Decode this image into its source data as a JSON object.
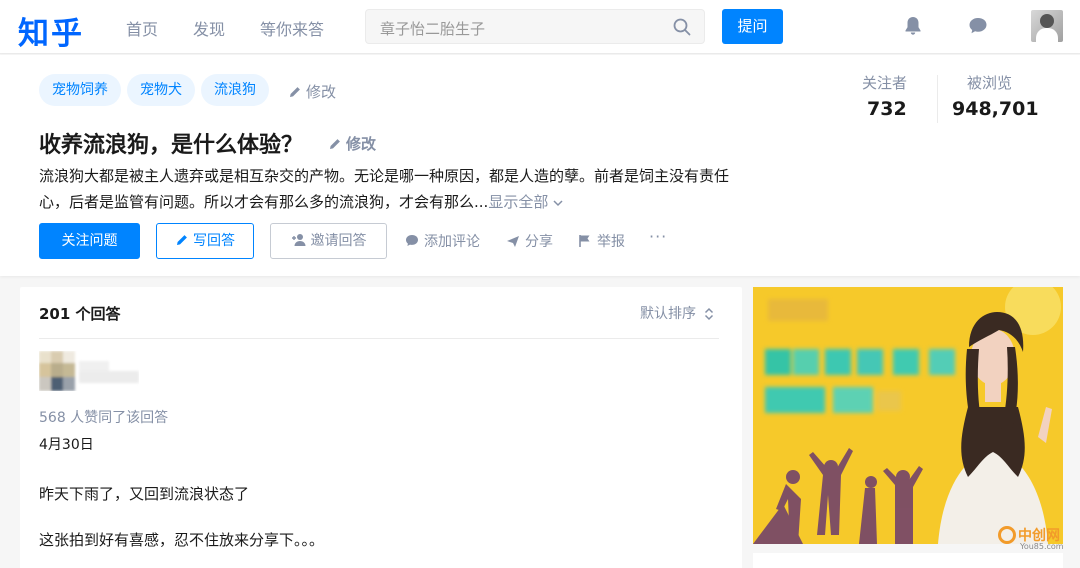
{
  "header": {
    "logo": "知乎",
    "nav": [
      "首页",
      "发现",
      "等你来答"
    ],
    "search_placeholder": "章子怡二胎生子",
    "ask_label": "提问"
  },
  "question": {
    "tags": [
      "宠物饲养",
      "宠物犬",
      "流浪狗"
    ],
    "tag_edit_label": "修改",
    "title": "收养流浪狗，是什么体验？",
    "title_edit_label": "修改",
    "description": "流浪狗大都是被主人遗弃或是相互杂交的产物。无论是哪一种原因，都是人造的孽。前者是饲主没有责任心，后者是监管有问题。所以才会有那么多的流浪狗，才会有那么...",
    "show_all_label": "显示全部",
    "stats": {
      "followers_label": "关注者",
      "followers_value": "732",
      "views_label": "被浏览",
      "views_value": "948,701"
    },
    "actions": {
      "follow": "关注问题",
      "write": "写回答",
      "invite": "邀请回答",
      "comment": "添加评论",
      "share": "分享",
      "report": "举报",
      "more": "···"
    }
  },
  "answers": {
    "count_label": "201 个回答",
    "sort_label": "默认排序",
    "first": {
      "likes_line": "568 人赞同了该回答",
      "date": "4月30日",
      "paragraphs": [
        "昨天下雨了，又回到流浪状态了",
        "这张拍到好有喜感，忍不住放来分享下。。。"
      ]
    }
  },
  "watermark": {
    "text": "中创网",
    "sub": "You85.com"
  },
  "colors": {
    "brand": "#0084ff",
    "muted": "#8590a6",
    "ad_bg": "#f6c92a"
  }
}
